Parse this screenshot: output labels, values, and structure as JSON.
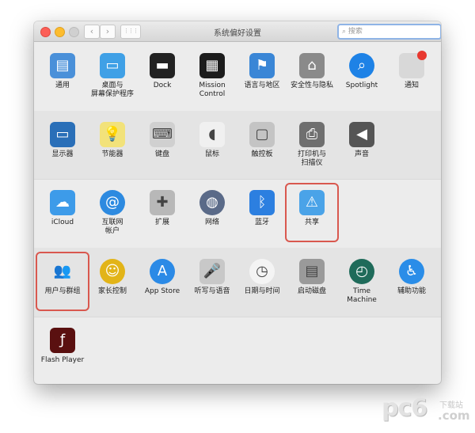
{
  "window": {
    "title": "系统偏好设置",
    "search_placeholder": "搜索",
    "back": "‹",
    "forward": "›",
    "grid": "⋮⋮⋮"
  },
  "sections": [
    {
      "items": [
        {
          "label": "通用",
          "icon": "general-icon",
          "color": "#4a90d9"
        },
        {
          "label": "桌面与\n屏幕保护程序",
          "icon": "desktop-screensaver-icon",
          "color": "#3fa0e6"
        },
        {
          "label": "Dock",
          "icon": "dock-icon",
          "color": "#222222"
        },
        {
          "label": "Mission\nControl",
          "icon": "mission-control-icon",
          "color": "#1c1c1c"
        },
        {
          "label": "语言与地区",
          "icon": "language-region-icon",
          "color": "#3a86d6"
        },
        {
          "label": "安全性与隐私",
          "icon": "security-privacy-icon",
          "color": "#8a8a8a"
        },
        {
          "label": "Spotlight",
          "icon": "spotlight-icon",
          "color": "#1e82e6"
        },
        {
          "label": "通知",
          "icon": "notifications-icon",
          "color": "#d8d8d8"
        }
      ]
    },
    {
      "items": [
        {
          "label": "显示器",
          "icon": "displays-icon",
          "color": "#2a6fb8"
        },
        {
          "label": "节能器",
          "icon": "energy-saver-icon",
          "color": "#f2e27a"
        },
        {
          "label": "键盘",
          "icon": "keyboard-icon",
          "color": "#d0d0d0"
        },
        {
          "label": "鼠标",
          "icon": "mouse-icon",
          "color": "#f0f0f0"
        },
        {
          "label": "触控板",
          "icon": "trackpad-icon",
          "color": "#c4c4c4"
        },
        {
          "label": "打印机与\n扫描仪",
          "icon": "printer-scanner-icon",
          "color": "#6f6f6f"
        },
        {
          "label": "声音",
          "icon": "sound-icon",
          "color": "#555555"
        }
      ]
    },
    {
      "items": [
        {
          "label": "iCloud",
          "icon": "icloud-icon",
          "color": "#3d9be9"
        },
        {
          "label": "互联网\n帐户",
          "icon": "internet-accounts-icon",
          "color": "#2d8ae0"
        },
        {
          "label": "扩展",
          "icon": "extensions-icon",
          "color": "#b8b8b8"
        },
        {
          "label": "网络",
          "icon": "network-icon",
          "color": "#5a6a88"
        },
        {
          "label": "蓝牙",
          "icon": "bluetooth-icon",
          "color": "#2c7fe0"
        },
        {
          "label": "共享",
          "icon": "sharing-icon",
          "color": "#4aa3e8",
          "highlighted": true
        }
      ]
    },
    {
      "items": [
        {
          "label": "用户与群组",
          "icon": "users-groups-icon",
          "color": "#222222",
          "highlighted": true
        },
        {
          "label": "家长控制",
          "icon": "parental-controls-icon",
          "color": "#e2b418"
        },
        {
          "label": "App Store",
          "icon": "app-store-icon",
          "color": "#2b8ae6"
        },
        {
          "label": "听写与语音",
          "icon": "dictation-speech-icon",
          "color": "#c8c8c8"
        },
        {
          "label": "日期与时间",
          "icon": "date-time-icon",
          "color": "#f4f4f4"
        },
        {
          "label": "启动磁盘",
          "icon": "startup-disk-icon",
          "color": "#9a9a9a"
        },
        {
          "label": "Time Machine",
          "icon": "time-machine-icon",
          "color": "#1f6b5a"
        },
        {
          "label": "辅助功能",
          "icon": "accessibility-icon",
          "color": "#2a8de8"
        }
      ]
    },
    {
      "items": [
        {
          "label": "Flash Player",
          "icon": "flash-player-icon",
          "color": "#5a1010"
        }
      ]
    }
  ],
  "highlight_color": "#d9584f",
  "watermark": {
    "logo": "pc6",
    "sub": "下载站",
    "domain": ".com"
  }
}
